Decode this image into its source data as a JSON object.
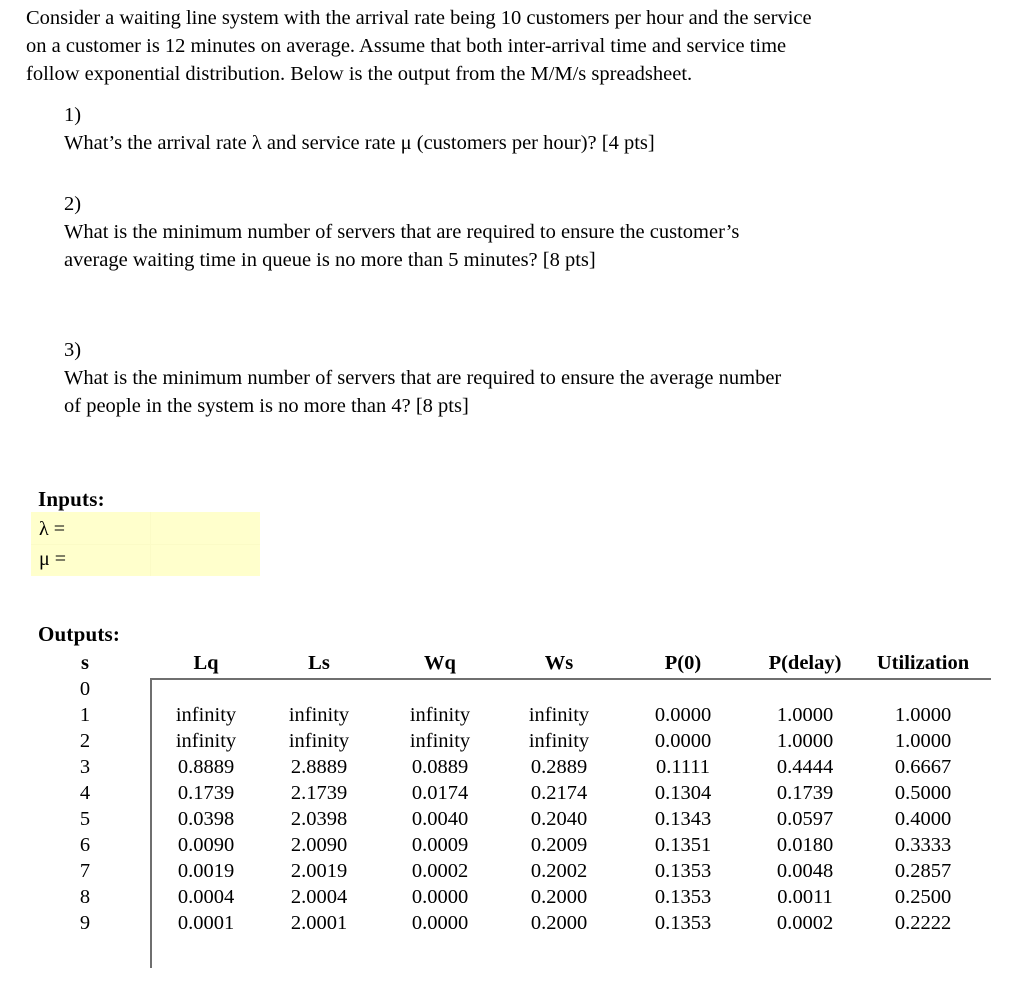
{
  "intro": {
    "lines": [
      "Consider a waiting line system with the arrival rate being 10 customers per hour and the service",
      "on a customer is 12 minutes on average. Assume that both inter-arrival time and service time",
      "follow exponential distribution. Below is the output from the M/M/s spreadsheet."
    ]
  },
  "questions": [
    {
      "number": "1)",
      "lines": [
        "What’s the arrival rate λ and service rate μ (customers per hour)? [4 pts]"
      ]
    },
    {
      "number": "2)",
      "lines": [
        "What is the minimum number of servers that are required to ensure the customer’s",
        "average waiting time in queue is no more than 5 minutes? [8 pts]"
      ]
    },
    {
      "number": "3)",
      "lines": [
        "What is the minimum number of servers that are required to ensure the average number",
        "of people in the system is no more than 4? [8 pts]"
      ]
    }
  ],
  "inputs": {
    "heading": "Inputs:",
    "lambda_label": "λ =",
    "lambda_value": "",
    "mu_label": "μ =",
    "mu_value": "",
    "highlight_color": "#FFFFCC"
  },
  "outputs": {
    "heading": "Outputs:",
    "columns": [
      "s",
      "Lq",
      "Ls",
      "Wq",
      "Ws",
      "P(0)",
      "P(delay)",
      "Utilization"
    ],
    "rows": [
      {
        "s": "0",
        "Lq": "",
        "Ls": "",
        "Wq": "",
        "Ws": "",
        "P0": "",
        "Pdelay": "",
        "Utilization": ""
      },
      {
        "s": "1",
        "Lq": "infinity",
        "Ls": "infinity",
        "Wq": "infinity",
        "Ws": "infinity",
        "P0": "0.0000",
        "Pdelay": "1.0000",
        "Utilization": "1.0000"
      },
      {
        "s": "2",
        "Lq": "infinity",
        "Ls": "infinity",
        "Wq": "infinity",
        "Ws": "infinity",
        "P0": "0.0000",
        "Pdelay": "1.0000",
        "Utilization": "1.0000"
      },
      {
        "s": "3",
        "Lq": "0.8889",
        "Ls": "2.8889",
        "Wq": "0.0889",
        "Ws": "0.2889",
        "P0": "0.1111",
        "Pdelay": "0.4444",
        "Utilization": "0.6667"
      },
      {
        "s": "4",
        "Lq": "0.1739",
        "Ls": "2.1739",
        "Wq": "0.0174",
        "Ws": "0.2174",
        "P0": "0.1304",
        "Pdelay": "0.1739",
        "Utilization": "0.5000"
      },
      {
        "s": "5",
        "Lq": "0.0398",
        "Ls": "2.0398",
        "Wq": "0.0040",
        "Ws": "0.2040",
        "P0": "0.1343",
        "Pdelay": "0.0597",
        "Utilization": "0.4000"
      },
      {
        "s": "6",
        "Lq": "0.0090",
        "Ls": "2.0090",
        "Wq": "0.0009",
        "Ws": "0.2009",
        "P0": "0.1351",
        "Pdelay": "0.0180",
        "Utilization": "0.3333"
      },
      {
        "s": "7",
        "Lq": "0.0019",
        "Ls": "2.0019",
        "Wq": "0.0002",
        "Ws": "0.2002",
        "P0": "0.1353",
        "Pdelay": "0.0048",
        "Utilization": "0.2857"
      },
      {
        "s": "8",
        "Lq": "0.0004",
        "Ls": "2.0004",
        "Wq": "0.0000",
        "Ws": "0.2000",
        "P0": "0.1353",
        "Pdelay": "0.0011",
        "Utilization": "0.2500"
      },
      {
        "s": "9",
        "Lq": "0.0001",
        "Ls": "2.0001",
        "Wq": "0.0000",
        "Ws": "0.2000",
        "P0": "0.1353",
        "Pdelay": "0.0002",
        "Utilization": "0.2222"
      }
    ]
  }
}
